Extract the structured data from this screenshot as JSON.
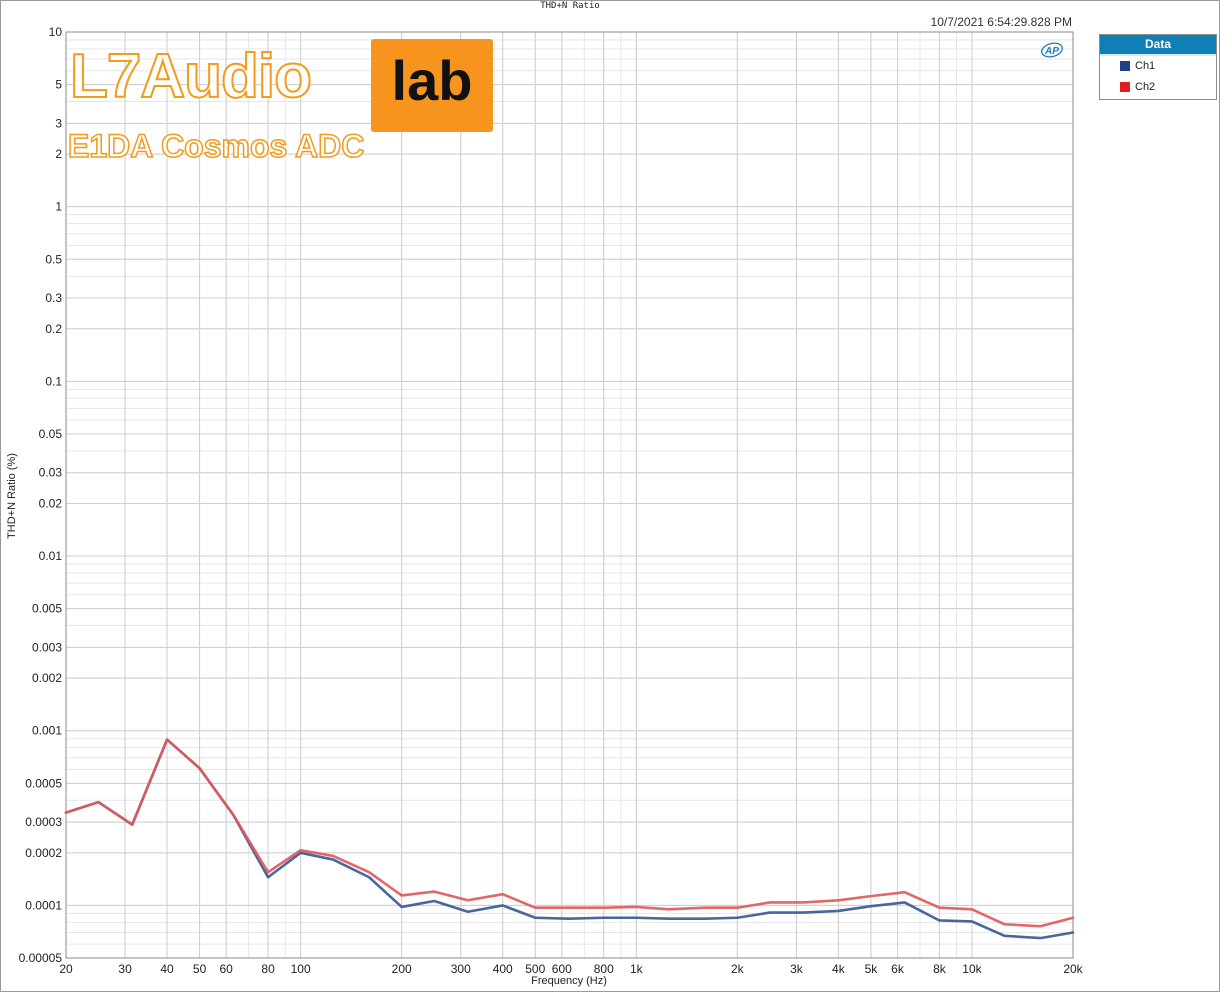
{
  "window": {
    "title": "THD+N Ratio",
    "timestamp": "10/7/2021 6:54:29.828 PM"
  },
  "watermark": {
    "brand_main": "L7Audio",
    "brand_box": "lab",
    "subtitle": "E1DA Cosmos ADC",
    "ap_logo_text": "AP"
  },
  "legend": {
    "title": "Data",
    "items": [
      {
        "label": "Ch1",
        "color": "#1f3f86"
      },
      {
        "label": "Ch2",
        "color": "#e02020"
      }
    ]
  },
  "chart_data": {
    "type": "line",
    "title": "THD+N Ratio",
    "xlabel": "Frequency (Hz)",
    "ylabel": "THD+N Ratio (%)",
    "xscale": "log",
    "yscale": "log",
    "xlim": [
      20,
      20000
    ],
    "ylim": [
      5e-05,
      10
    ],
    "grid": true,
    "legend_position": "outside-right",
    "x_ticks": [
      {
        "value": 20,
        "label": "20"
      },
      {
        "value": 30,
        "label": "30"
      },
      {
        "value": 40,
        "label": "40"
      },
      {
        "value": 50,
        "label": "50"
      },
      {
        "value": 60,
        "label": "60"
      },
      {
        "value": 80,
        "label": "80"
      },
      {
        "value": 100,
        "label": "100"
      },
      {
        "value": 200,
        "label": "200"
      },
      {
        "value": 300,
        "label": "300"
      },
      {
        "value": 400,
        "label": "400"
      },
      {
        "value": 500,
        "label": "500"
      },
      {
        "value": 600,
        "label": "600"
      },
      {
        "value": 800,
        "label": "800"
      },
      {
        "value": 1000,
        "label": "1k"
      },
      {
        "value": 2000,
        "label": "2k"
      },
      {
        "value": 3000,
        "label": "3k"
      },
      {
        "value": 4000,
        "label": "4k"
      },
      {
        "value": 5000,
        "label": "5k"
      },
      {
        "value": 6000,
        "label": "6k"
      },
      {
        "value": 8000,
        "label": "8k"
      },
      {
        "value": 10000,
        "label": "10k"
      },
      {
        "value": 20000,
        "label": "20k"
      }
    ],
    "y_ticks": [
      {
        "value": 10,
        "label": "10"
      },
      {
        "value": 5,
        "label": "5"
      },
      {
        "value": 3,
        "label": "3"
      },
      {
        "value": 2,
        "label": "2"
      },
      {
        "value": 1,
        "label": "1"
      },
      {
        "value": 0.5,
        "label": "0.5"
      },
      {
        "value": 0.3,
        "label": "0.3"
      },
      {
        "value": 0.2,
        "label": "0.2"
      },
      {
        "value": 0.1,
        "label": "0.1"
      },
      {
        "value": 0.05,
        "label": "0.05"
      },
      {
        "value": 0.03,
        "label": "0.03"
      },
      {
        "value": 0.02,
        "label": "0.02"
      },
      {
        "value": 0.01,
        "label": "0.01"
      },
      {
        "value": 0.005,
        "label": "0.005"
      },
      {
        "value": 0.003,
        "label": "0.003"
      },
      {
        "value": 0.002,
        "label": "0.002"
      },
      {
        "value": 0.001,
        "label": "0.001"
      },
      {
        "value": 0.0005,
        "label": "0.0005"
      },
      {
        "value": 0.0003,
        "label": "0.0003"
      },
      {
        "value": 0.0002,
        "label": "0.0002"
      },
      {
        "value": 0.0001,
        "label": "0.0001"
      },
      {
        "value": 5e-05,
        "label": "0.00005"
      }
    ],
    "x": [
      20,
      25,
      31.5,
      40,
      50,
      63,
      80,
      100,
      125,
      160,
      200,
      250,
      315,
      400,
      500,
      630,
      800,
      1000,
      1250,
      1600,
      2000,
      2500,
      3150,
      4000,
      5000,
      6300,
      8000,
      10000,
      12500,
      16000,
      20000
    ],
    "series": [
      {
        "name": "Ch1",
        "color": "#3a5a92",
        "values": [
          0.00034,
          0.00039,
          0.00029,
          0.00089,
          0.00061,
          0.00033,
          0.000145,
          0.0002,
          0.000183,
          0.000145,
          9.8e-05,
          0.000106,
          9.2e-05,
          0.0001,
          8.5e-05,
          8.4e-05,
          8.5e-05,
          8.5e-05,
          8.4e-05,
          8.4e-05,
          8.5e-05,
          9.1e-05,
          9.1e-05,
          9.3e-05,
          9.9e-05,
          0.000104,
          8.2e-05,
          8.1e-05,
          6.7e-05,
          6.5e-05,
          7e-05
        ]
      },
      {
        "name": "Ch2",
        "color": "#e05a5a",
        "values": [
          0.00034,
          0.00039,
          0.00029,
          0.00089,
          0.00061,
          0.00033,
          0.000155,
          0.000207,
          0.000192,
          0.000155,
          0.000114,
          0.00012,
          0.000107,
          0.000116,
          9.7e-05,
          9.7e-05,
          9.7e-05,
          9.8e-05,
          9.5e-05,
          9.7e-05,
          9.7e-05,
          0.000104,
          0.000104,
          0.000107,
          0.000113,
          0.000119,
          9.7e-05,
          9.5e-05,
          7.8e-05,
          7.6e-05,
          8.5e-05
        ]
      }
    ]
  }
}
